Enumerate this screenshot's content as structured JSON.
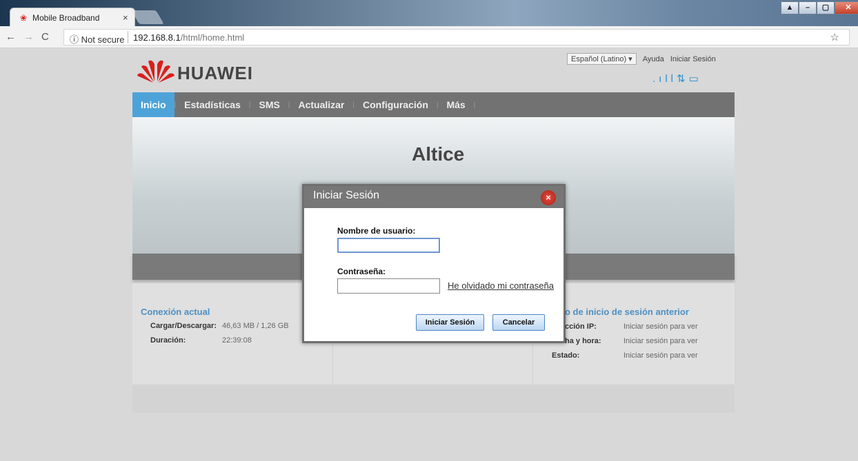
{
  "browser": {
    "tab_title": "Mobile Broadband",
    "tab_close": "×",
    "security_label": "ⓘ Not secure",
    "url_host": "192.168.8.1",
    "url_path": "/html/home.html"
  },
  "header": {
    "language": "Español (Latino) ▾",
    "help": "Ayuda",
    "login_link": "Iniciar Sesión",
    "logo_text": "HUAWEI",
    "brand_color": "#d8201d"
  },
  "nav": {
    "items": [
      {
        "label": "Inicio",
        "active": true
      },
      {
        "label": "Estadísticas"
      },
      {
        "label": "SMS"
      },
      {
        "label": "Actualizar"
      },
      {
        "label": "Configuración"
      },
      {
        "label": "Más"
      }
    ]
  },
  "banner": {
    "operator": "Altice"
  },
  "current_connection": {
    "heading": "Conexión actual",
    "upload_download_label": "Cargar/Descargar:",
    "upload_download_value": "46,63 MB / 1,26 GB",
    "duration_label": "Duración:",
    "duration_value": "22:39:08"
  },
  "previous_login": {
    "heading": "o de inicio de sesión anterior",
    "ip_label": "cción IP:",
    "ip_value": "Iniciar sesión para ver",
    "datetime_label": "ha y hora:",
    "datetime_value": "Iniciar sesión para ver",
    "status_label": "Estado:",
    "status_value": "Iniciar sesión para ver"
  },
  "login_dialog": {
    "title": "Iniciar Sesión",
    "close": "×",
    "username_label": "Nombre de usuario:",
    "username_value": "",
    "password_label": "Contraseña:",
    "password_value": "",
    "forgot_link": "He olvidado mi contraseña",
    "login_button": "Iniciar Sesión",
    "cancel_button": "Cancelar"
  }
}
